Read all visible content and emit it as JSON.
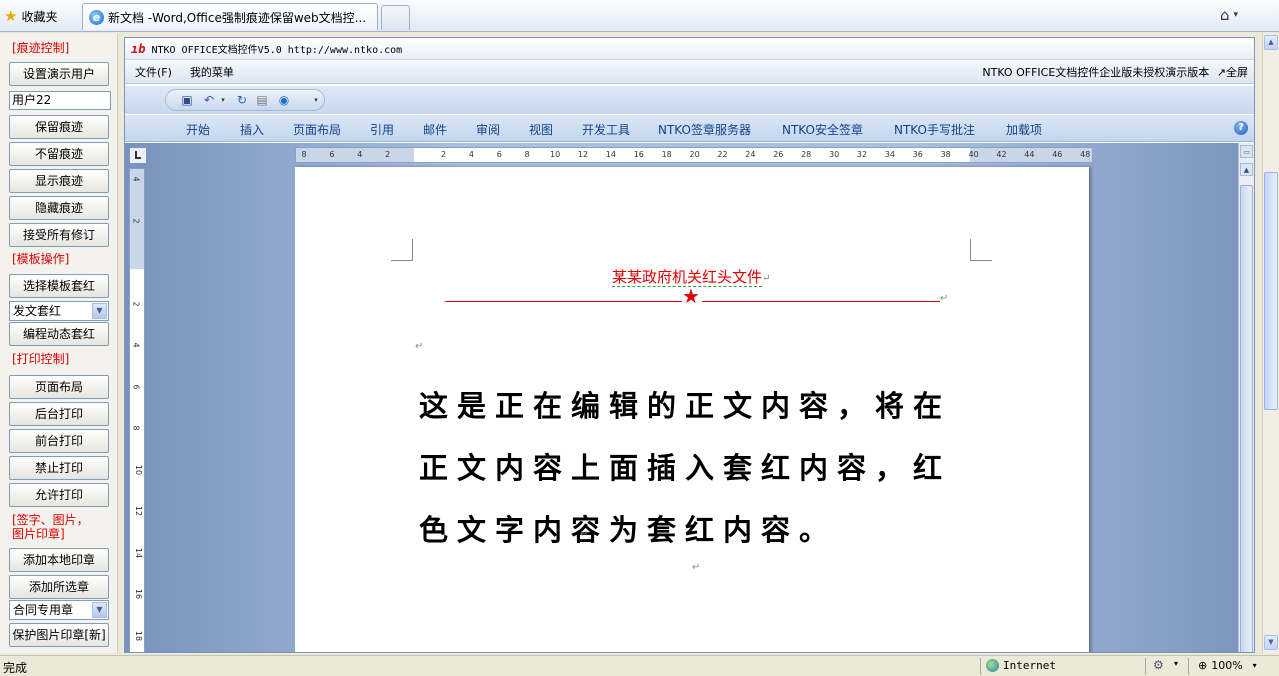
{
  "browser": {
    "favorites_label": "收藏夹",
    "tab_title": "新文档 -Word,Office强制痕迹保留web文档控...",
    "status_text": "完成",
    "zone_label": "Internet",
    "zoom_label": "100%"
  },
  "left_panel": {
    "section_trace": "[痕迹控制]",
    "set_user_button": "设置演示用户",
    "user_field_value": "用户22",
    "keep_trace_button": "保留痕迹",
    "no_trace_button": "不留痕迹",
    "show_trace_button": "显示痕迹",
    "hide_trace_button": "隐藏痕迹",
    "accept_all_button": "接受所有修订",
    "section_template": "[模板操作]",
    "choose_template_button": "选择模板套红",
    "template_select_value": "发文套红",
    "dynamic_template_button": "编程动态套红",
    "section_print": "[打印控制]",
    "page_layout_button": "页面布局",
    "background_print_button": "后台打印",
    "foreground_print_button": "前台打印",
    "forbid_print_button": "禁止打印",
    "allow_print_button": "允许打印",
    "section_signature_line1": "[签字、图片，",
    "section_signature_line2": "图片印章]",
    "add_local_stamp_button": "添加本地印章",
    "add_selected_stamp_button": "添加所选章",
    "stamp_select_value": "合同专用章",
    "protect_stamp_button": "保护图片印章[新]"
  },
  "control": {
    "title": "NTKO OFFICE文档控件V5.0 http://www.ntko.com",
    "menu_file": "文件(F)",
    "menu_mine": "我的菜单",
    "edition_notice": "NTKO OFFICE文档控件企业版未授权演示版本",
    "fullscreen_label": "↗全屏",
    "ribbon_tabs": [
      "开始",
      "插入",
      "页面布局",
      "引用",
      "邮件",
      "审阅",
      "视图",
      "开发工具",
      "NTKO签章服务器",
      "NTKO安全签章",
      "NTKO手写批注",
      "加载项"
    ],
    "hruler_ticks": [
      "8",
      "6",
      "4",
      "2",
      "",
      "2",
      "4",
      "6",
      "8",
      "10",
      "12",
      "14",
      "16",
      "18",
      "20",
      "22",
      "24",
      "26",
      "28",
      "30",
      "32",
      "34",
      "36",
      "38",
      "40",
      "42",
      "44",
      "46",
      "48"
    ],
    "vruler_ticks": [
      "4",
      "2",
      "",
      "2",
      "4",
      "6",
      "8",
      "10",
      "12",
      "14",
      "16",
      "18"
    ]
  },
  "document": {
    "red_header": "某某政府机关红头文件",
    "star": "★",
    "body": "这是正在编辑的正文内容，将在正文内容上面插入套红内容，红色文字内容为套红内容。",
    "pilcrow": "↵"
  },
  "icons": {
    "favorites": "star-icon",
    "tab": "ie-icon",
    "home": "home-icon",
    "save": "save-icon",
    "undo": "undo-icon",
    "redo": "redo-icon",
    "help": "help-icon",
    "zone": "globe-icon"
  },
  "colors": {
    "red_heading": "#e00000",
    "ribbon_text": "#15428b",
    "section_label": "#e00000"
  }
}
